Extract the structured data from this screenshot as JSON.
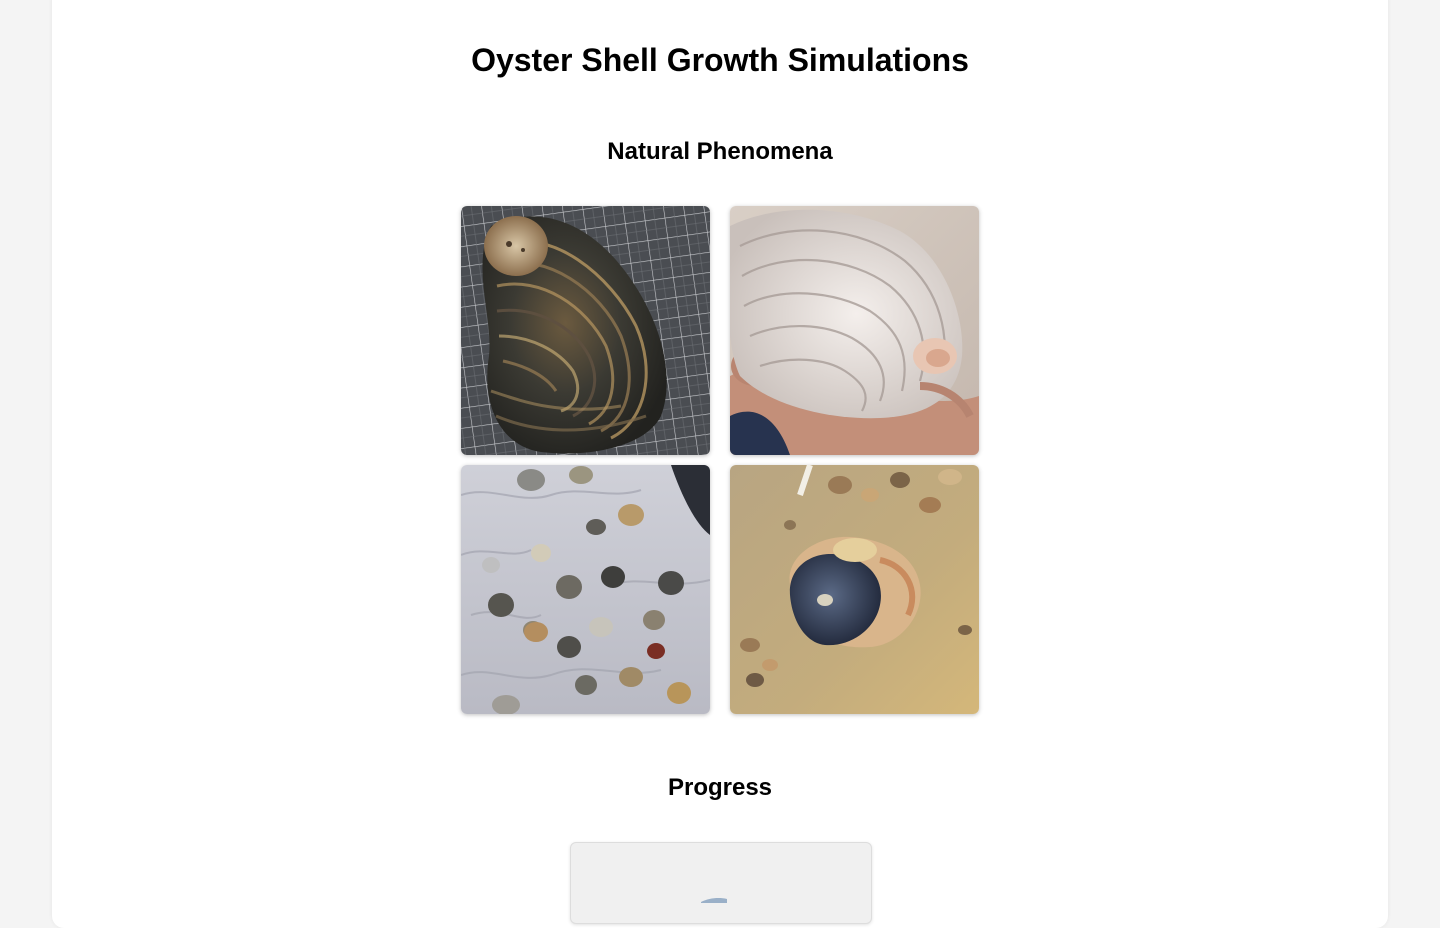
{
  "page": {
    "title": "Oyster Shell Growth Simulations"
  },
  "sections": {
    "natural": {
      "title": "Natural Phenomena",
      "photos": [
        {
          "icon": "oyster-shell-on-cutting-mat-photo"
        },
        {
          "icon": "white-oyster-shell-in-hand-photo"
        },
        {
          "icon": "shells-in-sand-photo"
        },
        {
          "icon": "oyster-in-shallow-water-photo"
        }
      ]
    },
    "progress": {
      "title": "Progress"
    }
  },
  "colors": {
    "page_background": "#f4f4f4",
    "card_background": "#ffffff",
    "text": "#000000"
  }
}
